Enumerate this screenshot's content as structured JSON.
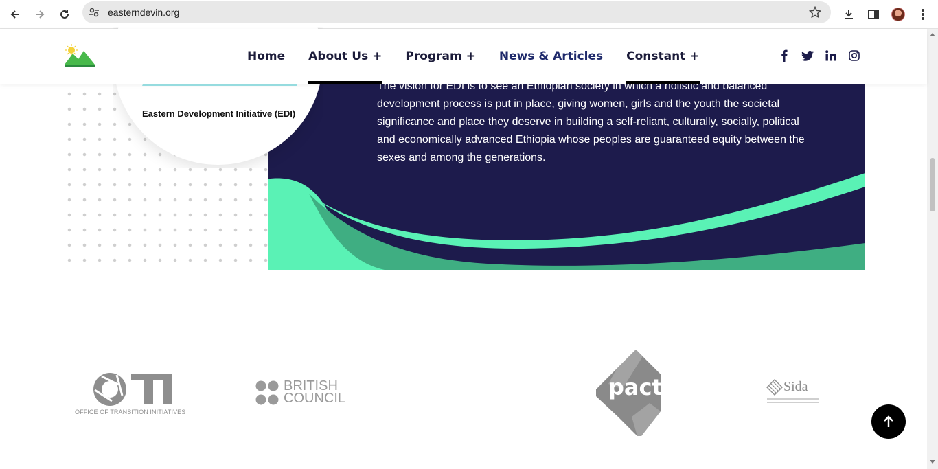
{
  "browser": {
    "url": "easterndevin.org"
  },
  "nav": {
    "items": [
      {
        "label": "Home"
      },
      {
        "label": "About Us +"
      },
      {
        "label": "Program +"
      },
      {
        "label": "News & Articles"
      },
      {
        "label": "Constant +"
      }
    ]
  },
  "socials": [
    {
      "icon": "facebook-icon",
      "glyph": "f"
    },
    {
      "icon": "twitter-icon"
    },
    {
      "icon": "linkedin-icon",
      "glyph": "in"
    },
    {
      "icon": "instagram-icon"
    }
  ],
  "vision": {
    "logo_caption": "Eastern Development Initiative (EDI)",
    "text": "The vision for EDI is to see an Ethiopian society in which a holistic and balanced development process is put in place, giving women, girls and the youth the societal significance and place they deserve in building a self-reliant, culturally, socially, political and economically advanced Ethiopia whose peoples are guaranteed equity between the sexes and among the generations."
  },
  "partners": {
    "oti": {
      "mark": "OTI",
      "caption": "OFFICE OF TRANSITION INITIATIVES"
    },
    "british_council": {
      "line1": "BRITISH",
      "line2": "COUNCIL"
    },
    "pact": {
      "name": "pact"
    },
    "sida": {
      "name": "Sida"
    }
  },
  "colors": {
    "vision_bg": "#1d1b4c",
    "wave_green": "#5af2b5",
    "wave_dark_green": "#3fae82",
    "logo_grey": "#9a9a9a"
  }
}
